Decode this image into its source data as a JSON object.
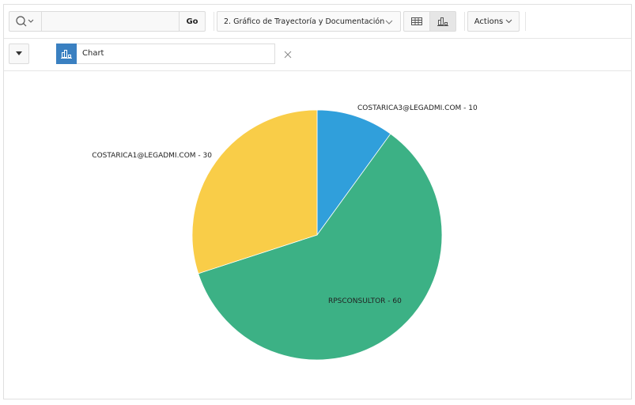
{
  "toolbar": {
    "search_icon": "search-icon",
    "search_value": "",
    "go_label": "Go",
    "report_select": "2. Gráfico de Trayectoría y Documentación",
    "view_grid_icon": "table-icon",
    "view_chart_icon": "bar-chart-icon",
    "actions_label": "Actions"
  },
  "filter": {
    "label": "Chart",
    "icon": "bar-chart-icon",
    "remove_icon": "close-icon"
  },
  "colors": {
    "accent": "#3a80c1",
    "blue": "#309fdb",
    "green": "#3cb185",
    "yellow": "#f9cd48"
  },
  "chart_data": {
    "type": "pie",
    "slices": [
      {
        "label": "COSTARICA3@LEGADMI.COM - 10",
        "name": "COSTARICA3@LEGADMI.COM",
        "value": 10,
        "color": "#309fdb"
      },
      {
        "label": "RPSCONSULTOR - 60",
        "name": "RPSCONSULTOR",
        "value": 60,
        "color": "#3cb185"
      },
      {
        "label": "COSTARICA1@LEGADMI.COM - 30",
        "name": "COSTARICA1@LEGADMI.COM",
        "value": 30,
        "color": "#f9cd48"
      }
    ]
  }
}
